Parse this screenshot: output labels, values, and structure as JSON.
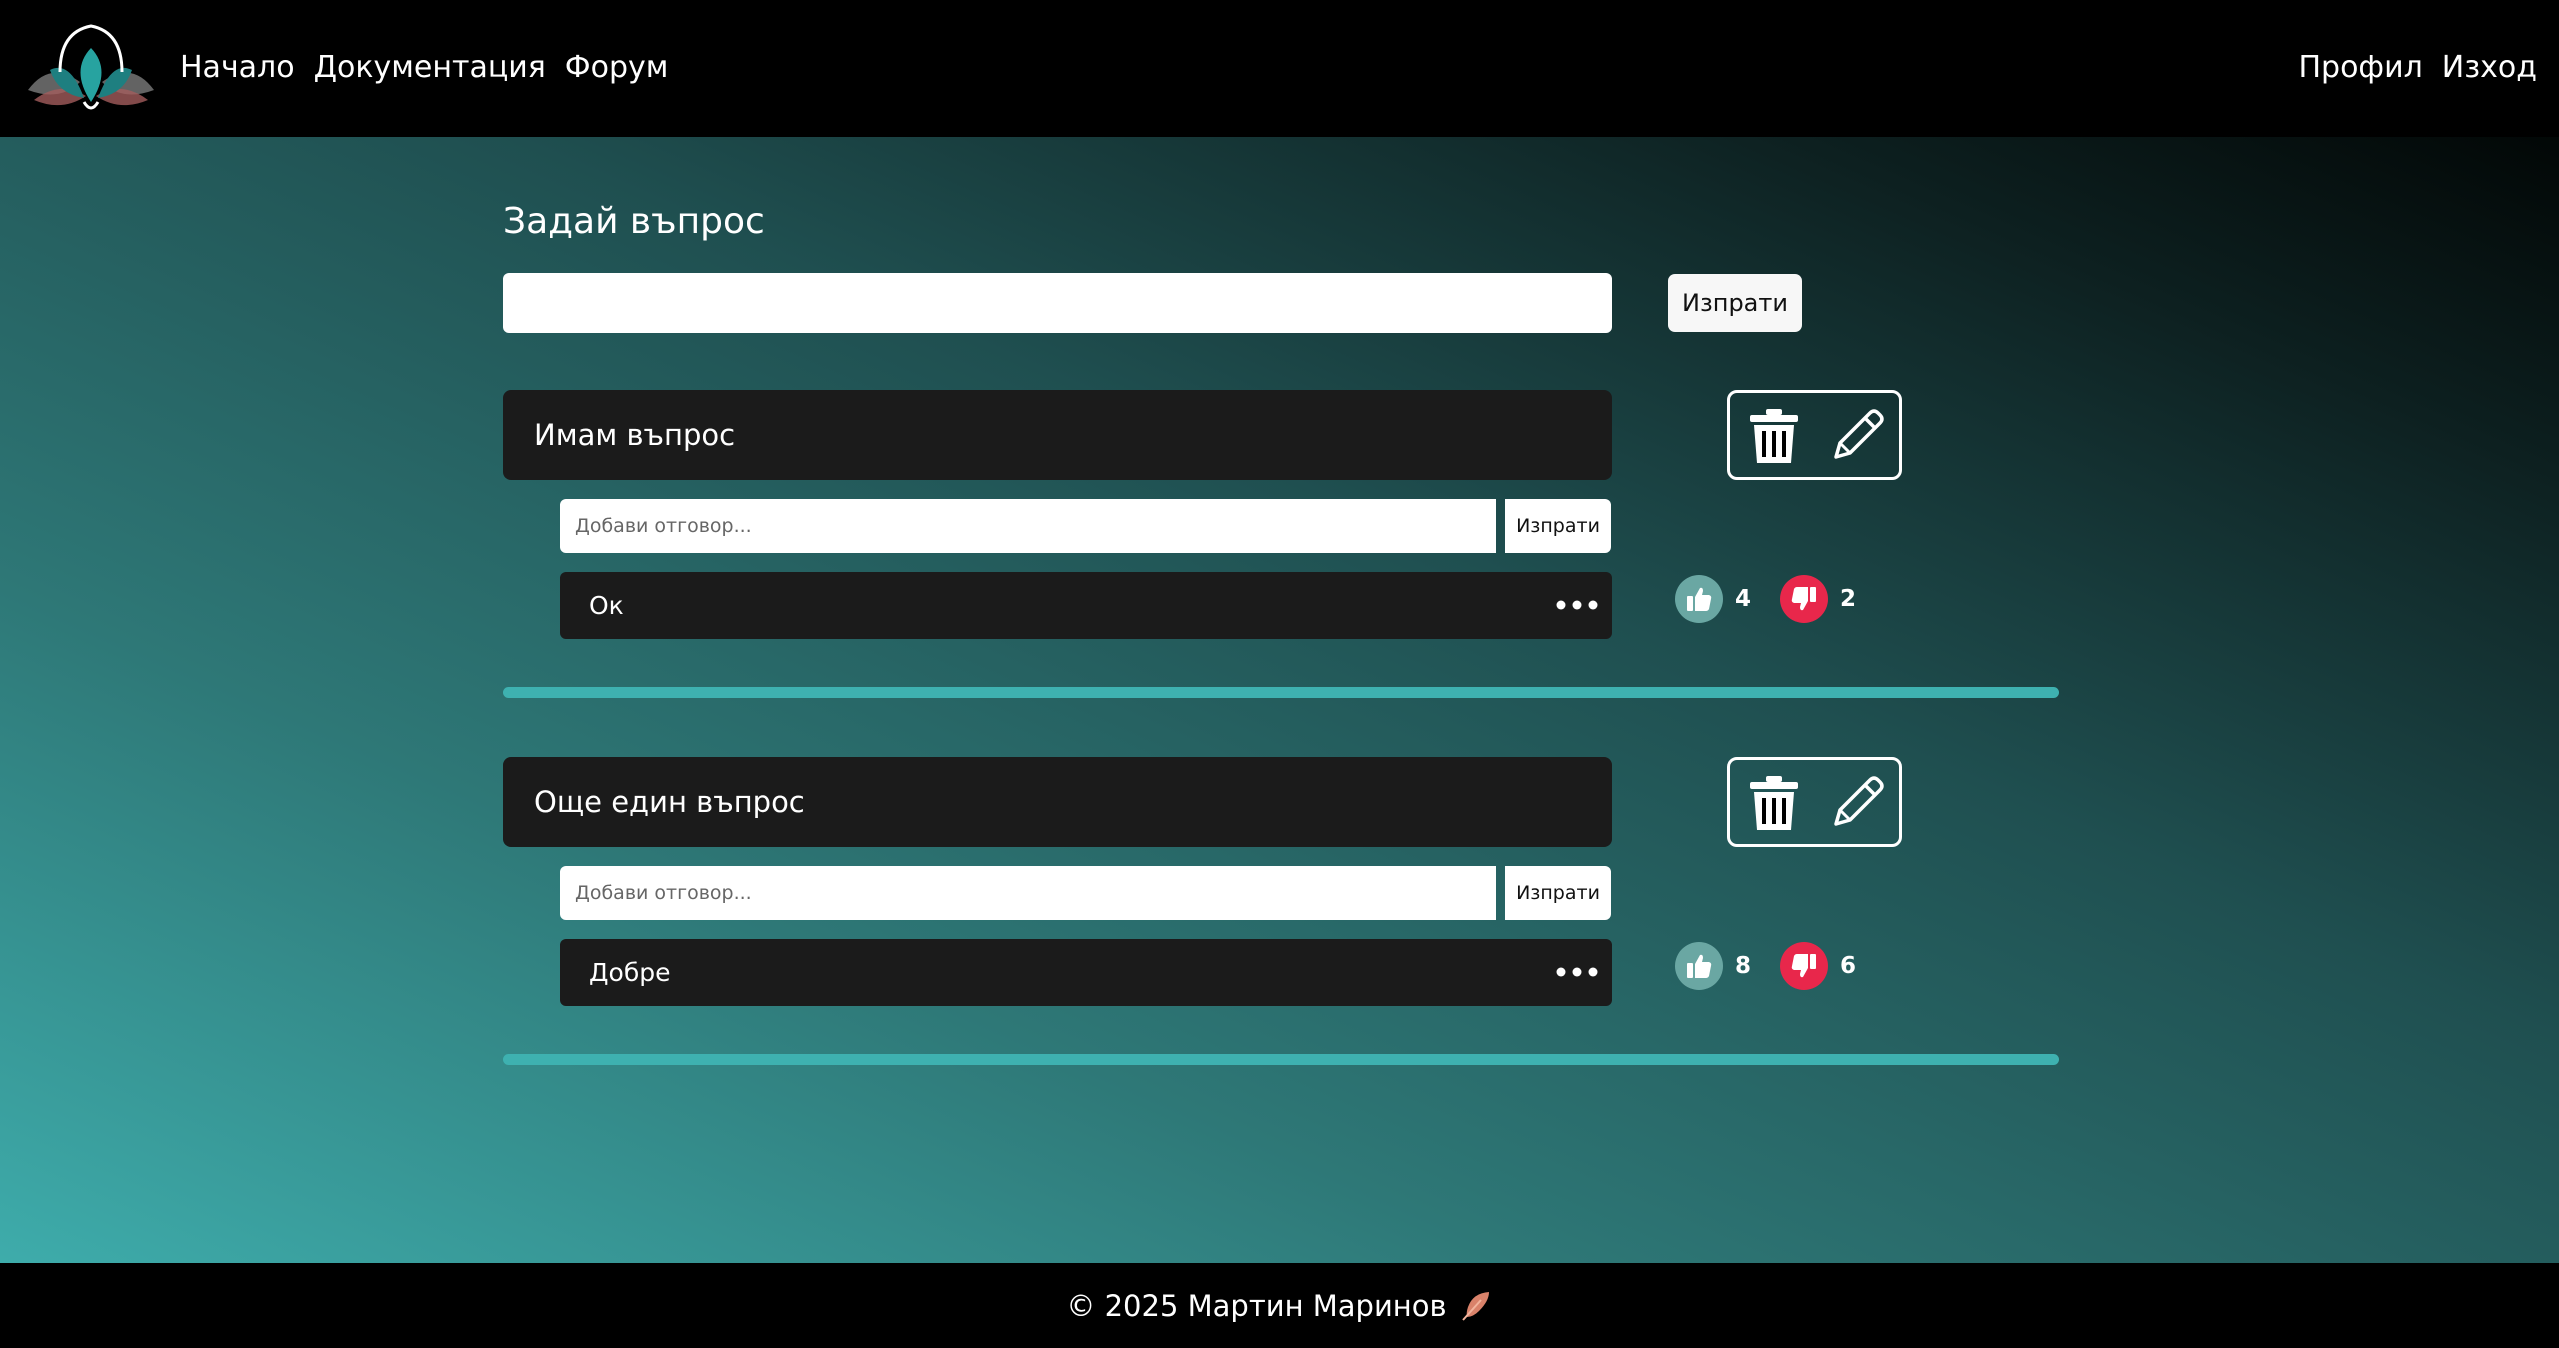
{
  "nav": {
    "left": [
      "Начало",
      "Документация",
      "Форум"
    ],
    "right": [
      "Профил",
      "Изход"
    ]
  },
  "ask": {
    "title": "Задай въпрос",
    "input_value": "",
    "send_label": "Изпрати"
  },
  "questions": [
    {
      "text": "Имам въпрос",
      "answer_placeholder": "Добави отговор...",
      "answer_send_label": "Изпрати",
      "answer": {
        "text": "Ок",
        "likes": "4",
        "dislikes": "2"
      }
    },
    {
      "text": "Още един въпрос",
      "answer_placeholder": "Добави отговор...",
      "answer_send_label": "Изпрати",
      "answer": {
        "text": "Добре",
        "likes": "8",
        "dislikes": "6"
      }
    }
  ],
  "footer": {
    "text": "© 2025 Мартин Маринов"
  },
  "icons": {
    "logo": "lotus-logo",
    "delete": "trash-icon",
    "edit": "pencil-icon",
    "more": "ellipsis-icon",
    "like": "thumbs-up-icon",
    "dislike": "thumbs-down-icon",
    "footer": "feather-icon"
  },
  "colors": {
    "like_bg": "#6aa7a3",
    "dislike_bg": "#e8274b",
    "divider": "#3eb1b0",
    "card_bg": "#1b1b1b"
  }
}
